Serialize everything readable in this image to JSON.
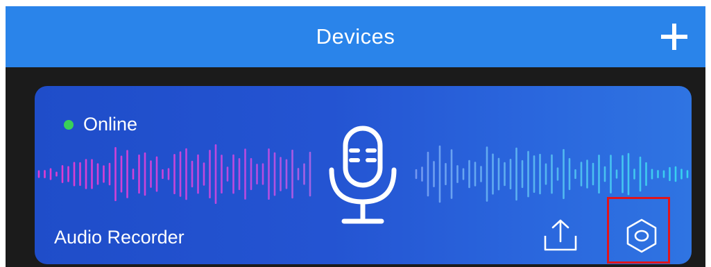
{
  "header": {
    "title": "Devices",
    "add_icon": "plus-icon"
  },
  "device_card": {
    "status_text": "Online",
    "status_color": "#39d158",
    "device_name": "Audio Recorder",
    "center_icon": "microphone-icon",
    "share_icon": "upload-share-icon",
    "settings_icon": "hexagon-settings-icon",
    "highlighted_element": "settings-button"
  },
  "colors": {
    "header_bg": "#2a84ea",
    "frame_bg": "#1b1b1b",
    "card_gradient_start": "#1f4dc9",
    "card_gradient_end": "#2f74e2",
    "wave_left": "#e23bd0",
    "wave_right": "#35d3f0",
    "highlight": "#e0141b"
  }
}
